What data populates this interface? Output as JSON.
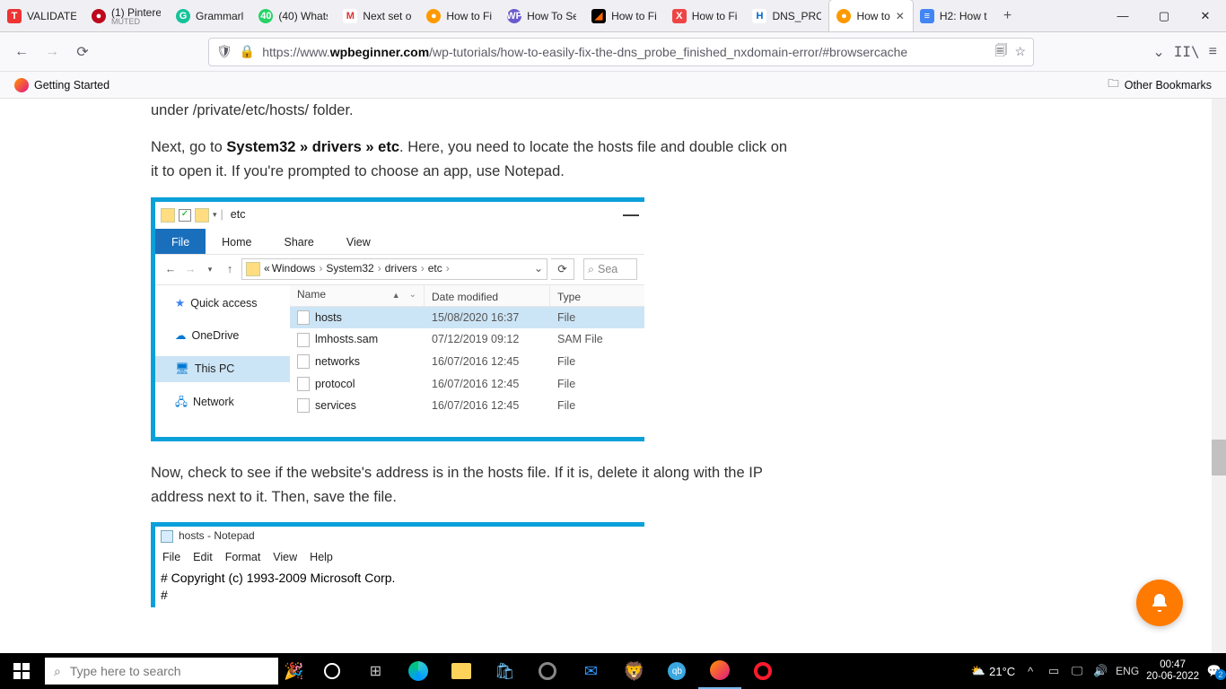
{
  "browser": {
    "tabs": [
      {
        "label": "VALIDATE",
        "icon_bg": "#e33",
        "icon_fg": "#fff",
        "icon_text": "T"
      },
      {
        "label": "(1) Pintere",
        "sub": "MUTED",
        "icon_bg": "#bd081c",
        "icon_fg": "#fff",
        "icon_text": "●",
        "round": true
      },
      {
        "label": "Grammarl",
        "icon_bg": "#15c39a",
        "icon_fg": "#fff",
        "icon_text": "G",
        "round": true
      },
      {
        "label": "(40) Whats",
        "icon_bg": "#25d366",
        "icon_fg": "#fff",
        "icon_text": "40",
        "round": true
      },
      {
        "label": "Next set o",
        "icon_bg": "#fff",
        "icon_fg": "#d33",
        "icon_text": "M"
      },
      {
        "label": "How to Fi",
        "icon_bg": "#f90",
        "icon_fg": "#fff",
        "icon_text": "●",
        "round": true
      },
      {
        "label": "How To Se",
        "icon_bg": "#6a5acd",
        "icon_fg": "#fff",
        "icon_text": "WP",
        "round": true
      },
      {
        "label": "How to Fi",
        "icon_bg": "#000",
        "icon_fg": "#f60",
        "icon_text": "◢"
      },
      {
        "label": "How to Fi",
        "icon_bg": "#e44",
        "icon_fg": "#fff",
        "icon_text": "X"
      },
      {
        "label": "DNS_PRO",
        "icon_bg": "#fff",
        "icon_fg": "#06c",
        "icon_text": "H"
      },
      {
        "label": "How to",
        "icon_bg": "#f90",
        "icon_fg": "#fff",
        "icon_text": "●",
        "round": true,
        "active": true,
        "closeable": true
      },
      {
        "label": "H2: How t",
        "icon_bg": "#4285f4",
        "icon_fg": "#fff",
        "icon_text": "≡"
      }
    ],
    "url_prefix": "https://www.",
    "url_host": "wpbeginner.com",
    "url_path": "/wp-tutorials/how-to-easily-fix-the-dns_probe_finished_nxdomain-error/#browsercache",
    "bookmarks": {
      "getting_started": "Getting Started",
      "other": "Other Bookmarks"
    }
  },
  "article": {
    "p0b": "under /private/etc/hosts/ folder.",
    "p1a": "Next, go to ",
    "p1b": "System32 » drivers » etc",
    "p1c": ". Here, you need to locate the hosts file and double click on it to open it. If you're prompted to choose an app, use Notepad.",
    "p2": "Now, check to see if the website's address is in the hosts file. If it is, delete it along with the IP address next to it. Then, save the file."
  },
  "explorer": {
    "title": "etc",
    "ribbon": {
      "file": "File",
      "home": "Home",
      "share": "Share",
      "view": "View"
    },
    "crumbs": [
      "Windows",
      "System32",
      "drivers",
      "etc"
    ],
    "search_placeholder": "Sea",
    "nav": {
      "quick": "Quick access",
      "onedrive": "OneDrive",
      "thispc": "This PC",
      "network": "Network"
    },
    "headers": {
      "name": "Name",
      "date": "Date modified",
      "type": "Type"
    },
    "files": [
      {
        "name": "hosts",
        "date": "15/08/2020 16:37",
        "type": "File",
        "sel": true
      },
      {
        "name": "lmhosts.sam",
        "date": "07/12/2019 09:12",
        "type": "SAM File"
      },
      {
        "name": "networks",
        "date": "16/07/2016 12:45",
        "type": "File"
      },
      {
        "name": "protocol",
        "date": "16/07/2016 12:45",
        "type": "File"
      },
      {
        "name": "services",
        "date": "16/07/2016 12:45",
        "type": "File"
      }
    ]
  },
  "notepad": {
    "title": "hosts - Notepad",
    "menu": [
      "File",
      "Edit",
      "Format",
      "View",
      "Help"
    ],
    "body_l1": "# Copyright (c) 1993-2009 Microsoft Corp.",
    "body_l2": "#"
  },
  "taskbar": {
    "search_placeholder": "Type here to search",
    "weather_temp": "21°C",
    "lang": "ENG",
    "time": "00:47",
    "date": "20-06-2022",
    "notif_count": "2"
  }
}
